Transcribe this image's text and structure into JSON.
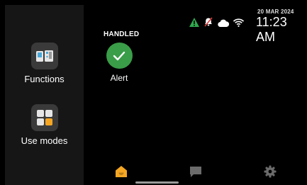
{
  "colors": {
    "accent": "#f5a623",
    "handled": "#3a9d48",
    "warning": "#2fa84f",
    "muted_icon": "#6b6b6b"
  },
  "status_bar": {
    "date": "20 MAR 2024",
    "time": "11:23 AM",
    "icons": [
      "warning-icon",
      "bell-muted-icon",
      "cloud-icon",
      "wifi-icon"
    ]
  },
  "side_panel": {
    "items": [
      {
        "label": "Functions",
        "icon": "functions-icon"
      },
      {
        "label": "Use modes",
        "icon": "use-modes-icon"
      }
    ]
  },
  "main": {
    "section_title": "HANDLED",
    "alert": {
      "label": "Alert",
      "icon": "check-icon"
    }
  },
  "bottom_nav": {
    "items": [
      {
        "name": "home",
        "icon": "home-icon",
        "active": true
      },
      {
        "name": "messages",
        "icon": "chat-icon",
        "active": false
      },
      {
        "name": "settings",
        "icon": "gear-icon",
        "active": false
      }
    ]
  }
}
